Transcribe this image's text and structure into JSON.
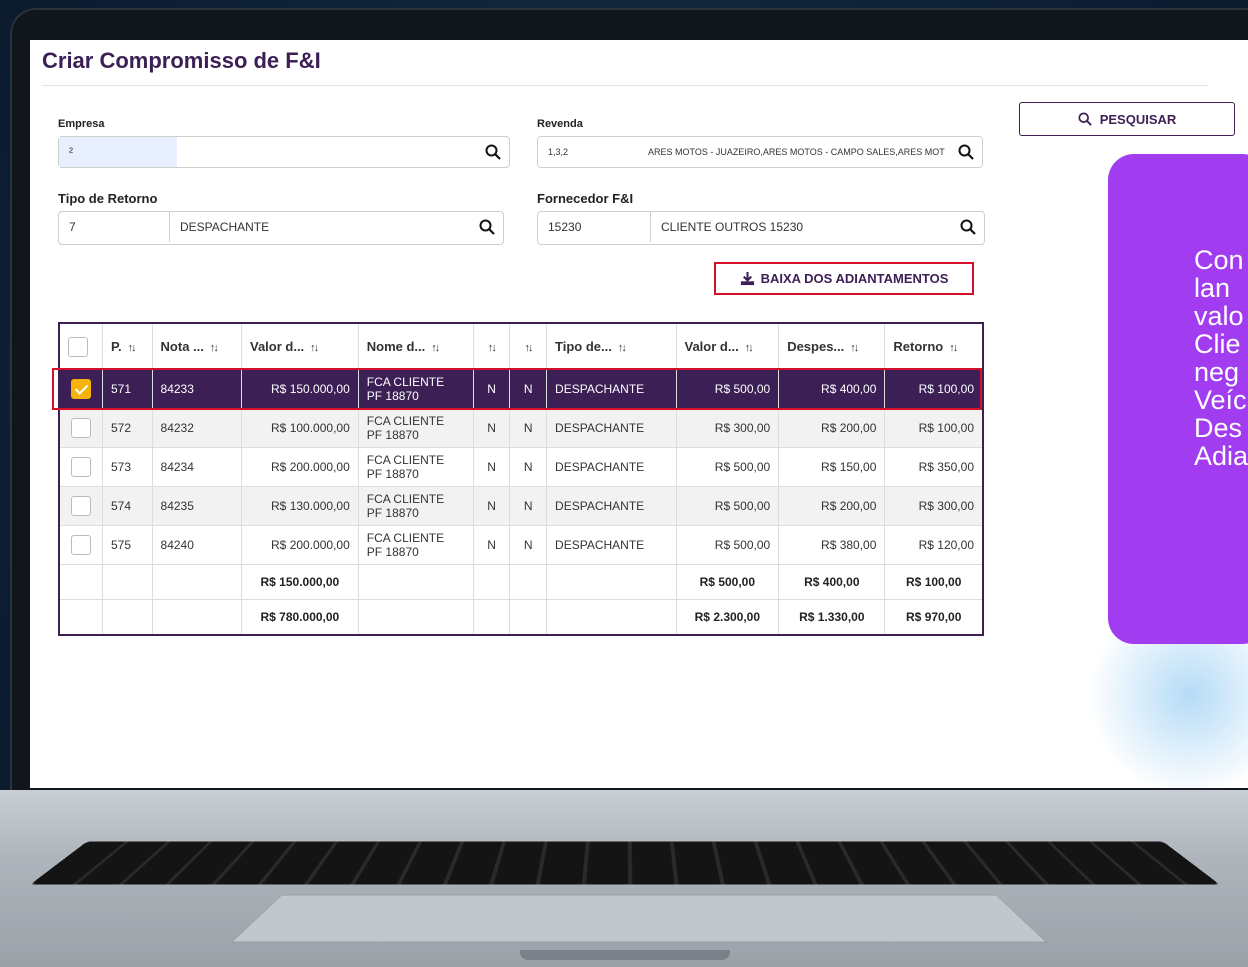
{
  "app": {
    "title": "Criar Compromisso de F&I"
  },
  "toolbar": {
    "search_label": "PESQUISAR",
    "baixa_label": "BAIXA DOS ADIANTAMENTOS"
  },
  "fields": {
    "empresa": {
      "label": "Empresa",
      "code": "²",
      "desc": ""
    },
    "revenda": {
      "label": "Revenda",
      "code": "1,3,2",
      "desc": "ARES MOTOS - JUAZEIRO,ARES MOTOS - CAMPO SALES,ARES MOT"
    },
    "tipo_retorno": {
      "label": "Tipo de Retorno",
      "code": "7",
      "desc": "DESPACHANTE"
    },
    "fornecedor": {
      "label": "Fornecedor F&I",
      "code": "15230",
      "desc": "CLIENTE OUTROS 15230"
    }
  },
  "table": {
    "headers": [
      "P.",
      "Nota ...",
      "Valor d...",
      "Nome d...",
      "",
      "",
      "Tipo de...",
      "Valor d...",
      "Despes...",
      "Retorno"
    ],
    "rows": [
      {
        "p": "571",
        "nota": "84233",
        "valor": "R$ 150.000,00",
        "nome1": "FCA CLIENTE",
        "nome2": "PF 18870",
        "c1": "N",
        "c2": "N",
        "tipo": "DESPACHANTE",
        "valor2": "R$ 500,00",
        "despesa": "R$ 400,00",
        "retorno": "R$ 100,00",
        "checked": true
      },
      {
        "p": "572",
        "nota": "84232",
        "valor": "R$ 100.000,00",
        "nome1": "FCA CLIENTE",
        "nome2": "PF 18870",
        "c1": "N",
        "c2": "N",
        "tipo": "DESPACHANTE",
        "valor2": "R$ 300,00",
        "despesa": "R$ 200,00",
        "retorno": "R$ 100,00",
        "checked": false
      },
      {
        "p": "573",
        "nota": "84234",
        "valor": "R$ 200.000,00",
        "nome1": "FCA CLIENTE",
        "nome2": "PF 18870",
        "c1": "N",
        "c2": "N",
        "tipo": "DESPACHANTE",
        "valor2": "R$ 500,00",
        "despesa": "R$ 150,00",
        "retorno": "R$ 350,00",
        "checked": false
      },
      {
        "p": "574",
        "nota": "84235",
        "valor": "R$ 130.000,00",
        "nome1": "FCA CLIENTE",
        "nome2": "PF 18870",
        "c1": "N",
        "c2": "N",
        "tipo": "DESPACHANTE",
        "valor2": "R$ 500,00",
        "despesa": "R$ 200,00",
        "retorno": "R$ 300,00",
        "checked": false
      },
      {
        "p": "575",
        "nota": "84240",
        "valor": "R$ 200.000,00",
        "nome1": "FCA CLIENTE",
        "nome2": "PF 18870",
        "c1": "N",
        "c2": "N",
        "tipo": "DESPACHANTE",
        "valor2": "R$ 500,00",
        "despesa": "R$ 380,00",
        "retorno": "R$ 120,00",
        "checked": false
      }
    ],
    "totals": [
      {
        "valor": "R$ 150.000,00",
        "valor2": "R$ 500,00",
        "despesa": "R$ 400,00",
        "retorno": "R$ 100,00"
      },
      {
        "valor": "R$ 780.000,00",
        "valor2": "R$ 2.300,00",
        "despesa": "R$ 1.330,00",
        "retorno": "R$ 970,00"
      }
    ]
  },
  "callout": {
    "lines": [
      "Con",
      "lan",
      "valo",
      "Clie",
      "neg",
      "Veíc",
      "Des",
      "Adia"
    ]
  },
  "colors": {
    "accent": "#3b1f55",
    "highlight": "#d7102a",
    "check": "#f5b30a",
    "callout": "#a23cf0"
  }
}
